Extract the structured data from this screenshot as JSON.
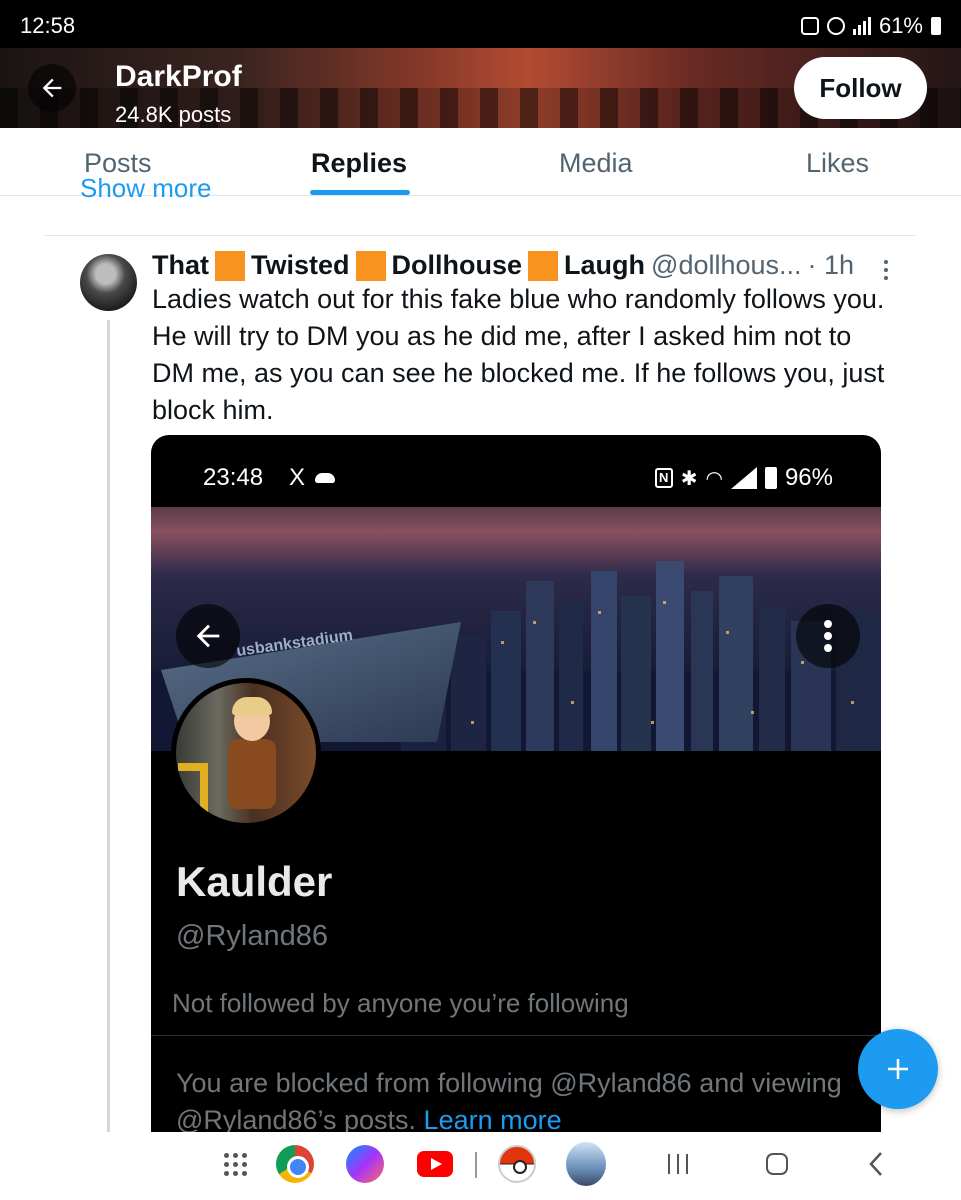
{
  "status_bar": {
    "time": "12:58",
    "battery": "61%"
  },
  "header": {
    "title": "DarkProf",
    "subtitle": "24.8K posts",
    "follow_label": "Follow"
  },
  "tabs": [
    {
      "label": "Posts",
      "active": false
    },
    {
      "label": "Replies",
      "active": true
    },
    {
      "label": "Media",
      "active": false
    },
    {
      "label": "Likes",
      "active": false
    }
  ],
  "show_more": "Show more",
  "post": {
    "name_parts": [
      "That",
      "Twisted",
      "Dollhouse",
      "Laugh"
    ],
    "handle": "@dollhous...",
    "time": "· 1h",
    "text": "Ladies watch out for this fake blue who randomly follows you. He will try to DM you as he did me, after I asked him not to DM me, as you can see he blocked me. If he follows you, just block him."
  },
  "embedded": {
    "status_time": "23:48",
    "status_x": "X",
    "status_battery": "96%",
    "stadium_text": "usbankstadium",
    "profile_name": "Kaulder",
    "profile_handle": "@Ryland86",
    "not_followed": "Not followed by anyone you’re following",
    "blocked_text": "You are blocked from following @Ryland86 and viewing @Ryland86’s posts. ",
    "learn_more": "Learn more"
  },
  "colors": {
    "accent": "#1d9bf0",
    "emoji_square": "#f7931e"
  },
  "icons": {
    "back": "arrow-left-icon",
    "more": "more-vertical-icon",
    "compose": "plus-icon"
  }
}
